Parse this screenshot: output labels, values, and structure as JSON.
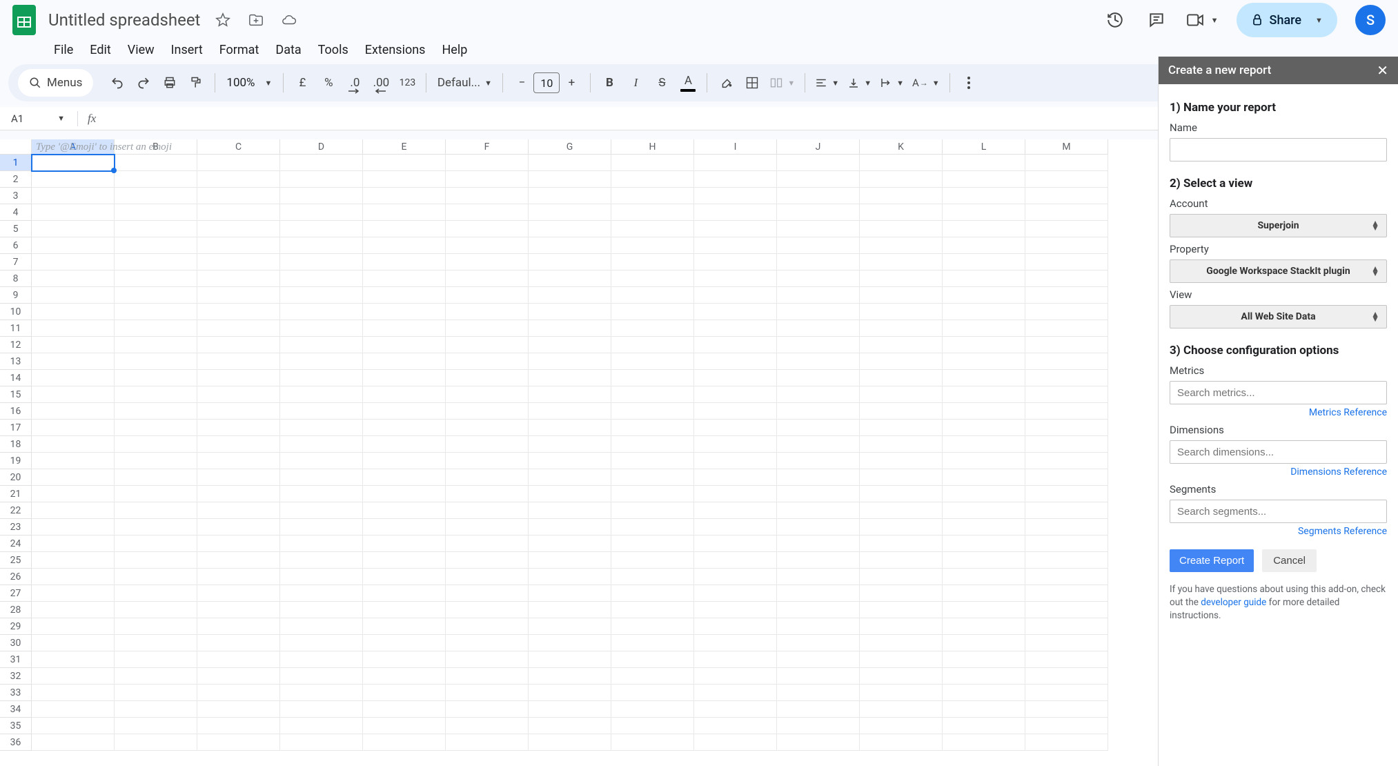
{
  "header": {
    "doc_title": "Untitled spreadsheet",
    "share_label": "Share",
    "avatar_letter": "S"
  },
  "menu": {
    "items": [
      "File",
      "Edit",
      "View",
      "Insert",
      "Format",
      "Data",
      "Tools",
      "Extensions",
      "Help"
    ]
  },
  "toolbar": {
    "menus_label": "Menus",
    "zoom": "100%",
    "currency_symbol": "£",
    "percent_symbol": "%",
    "dec_dec": ".0",
    "dec_inc": ".00",
    "num123": "123",
    "font_name": "Defaul...",
    "font_size": "10"
  },
  "namebox": {
    "cell_ref": "A1"
  },
  "grid": {
    "columns": [
      "A",
      "B",
      "C",
      "D",
      "E",
      "F",
      "G",
      "H",
      "I",
      "J",
      "K",
      "L",
      "M"
    ],
    "row_count": 36,
    "selected": {
      "row": 1,
      "col": 0
    },
    "placeholder_hint": "Type '@Emoji' to insert an emoji"
  },
  "sidebar": {
    "title": "Create a new report",
    "step1_title": "1) Name your report",
    "name_label": "Name",
    "name_value": "",
    "step2_title": "2) Select a view",
    "account_label": "Account",
    "account_value": "Superjoin",
    "property_label": "Property",
    "property_value": "Google Workspace StackIt plugin",
    "view_label": "View",
    "view_value": "All Web Site Data",
    "step3_title": "3) Choose configuration options",
    "metrics_label": "Metrics",
    "metrics_placeholder": "Search metrics...",
    "metrics_link": "Metrics Reference",
    "dimensions_label": "Dimensions",
    "dimensions_placeholder": "Search dimensions...",
    "dimensions_link": "Dimensions Reference",
    "segments_label": "Segments",
    "segments_placeholder": "Search segments...",
    "segments_link": "Segments Reference",
    "create_btn": "Create Report",
    "cancel_btn": "Cancel",
    "footer_pre": "If you have questions about using this add-on, check out the ",
    "footer_link": "developer guide",
    "footer_post": " for more detailed instructions."
  }
}
